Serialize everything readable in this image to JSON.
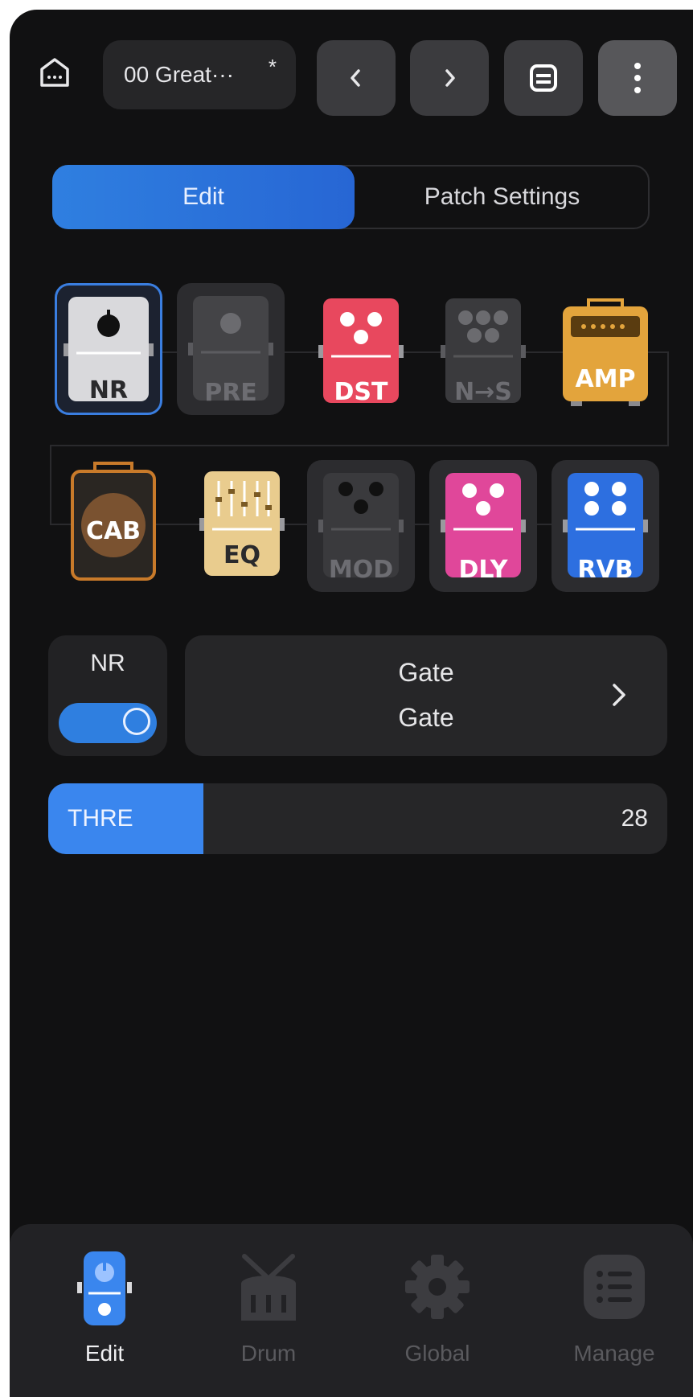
{
  "header": {
    "patch_name": "00 Great···",
    "modified_marker": "*"
  },
  "tabs": [
    {
      "label": "Edit",
      "active": true
    },
    {
      "label": "Patch Settings",
      "active": false
    }
  ],
  "effect_chain": [
    {
      "label": "NR",
      "selected": true,
      "on": true
    },
    {
      "label": "PRE",
      "on": false
    },
    {
      "label": "DST",
      "on": true
    },
    {
      "label": "N→S",
      "on": false
    },
    {
      "label": "AMP",
      "on": true
    },
    {
      "label": "CAB",
      "on": true
    },
    {
      "label": "EQ",
      "on": true
    },
    {
      "label": "MOD",
      "on": false
    },
    {
      "label": "DLY",
      "on": true
    },
    {
      "label": "RVB",
      "on": true
    }
  ],
  "block": {
    "name": "NR",
    "enabled": true,
    "model_category": "Gate",
    "model_name": "Gate"
  },
  "params": [
    {
      "name": "THRE",
      "value": "28",
      "level_fraction": 0.25
    }
  ],
  "bottom_nav": [
    {
      "label": "Edit",
      "active": true
    },
    {
      "label": "Drum",
      "active": false
    },
    {
      "label": "Global",
      "active": false
    },
    {
      "label": "Manage",
      "active": false
    }
  ],
  "colors": {
    "accent": "#2F7FE0",
    "background": "#111112",
    "dst": "#E8485E",
    "amp": "#E3A43C",
    "cab": "#C87A2A",
    "eq": "#E9CC8E",
    "dly": "#E0479A",
    "rvb": "#2D6FE0"
  }
}
